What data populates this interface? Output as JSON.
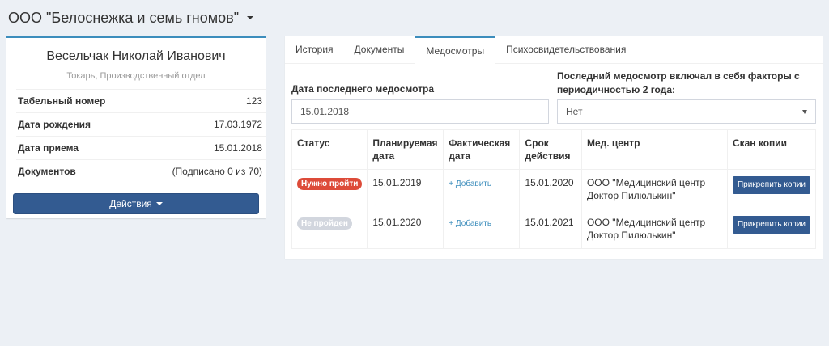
{
  "company": {
    "name": "ООО \"Белоснежка и семь гномов\""
  },
  "profile": {
    "name": "Весельчак Николай Иванович",
    "position": "Токарь, Производственный отдел",
    "info": [
      {
        "label": "Табельный номер",
        "value": "123"
      },
      {
        "label": "Дата рождения",
        "value": "17.03.1972"
      },
      {
        "label": "Дата приема",
        "value": "15.01.2018"
      },
      {
        "label": "Документов",
        "value": "(Подписано 0 из 70)"
      }
    ],
    "actions_label": "Действия"
  },
  "tabs": [
    {
      "label": "История",
      "active": false
    },
    {
      "label": "Документы",
      "active": false
    },
    {
      "label": "Медосмотры",
      "active": true
    },
    {
      "label": "Психосвидетельствования",
      "active": false
    }
  ],
  "form": {
    "last_exam_label": "Дата последнего медосмотра",
    "last_exam_value": "15.01.2018",
    "factors_label": "Последний медосмотр включал в себя факторы с периодичностью 2 года:",
    "factors_value": "Нет"
  },
  "table": {
    "headers": [
      "Статус",
      "Планируемая дата",
      "Фактическая дата",
      "Срок действия",
      "Мед. центр",
      "Скан копии"
    ],
    "rows": [
      {
        "status": "Нужно пройти",
        "status_color": "#dd4b39",
        "planned": "15.01.2019",
        "actual_action": "+ Добавить",
        "valid_until": "15.01.2020",
        "center": "ООО \"Медицинский центр Доктор Пилюлькин\"",
        "scan_action": "Прикрепить копии"
      },
      {
        "status": "Не пройден",
        "status_color": "#d2d6de",
        "planned": "15.01.2020",
        "actual_action": "+ Добавить",
        "valid_until": "15.01.2021",
        "center": "ООО \"Медицинский центр Доктор Пилюлькин\"",
        "scan_action": "Прикрепить копии"
      }
    ]
  },
  "colors": {
    "accent": "#3c8dbc",
    "primary_button": "#335b91",
    "danger": "#dd4b39",
    "muted": "#d2d6de",
    "background": "#ecf0f5"
  }
}
